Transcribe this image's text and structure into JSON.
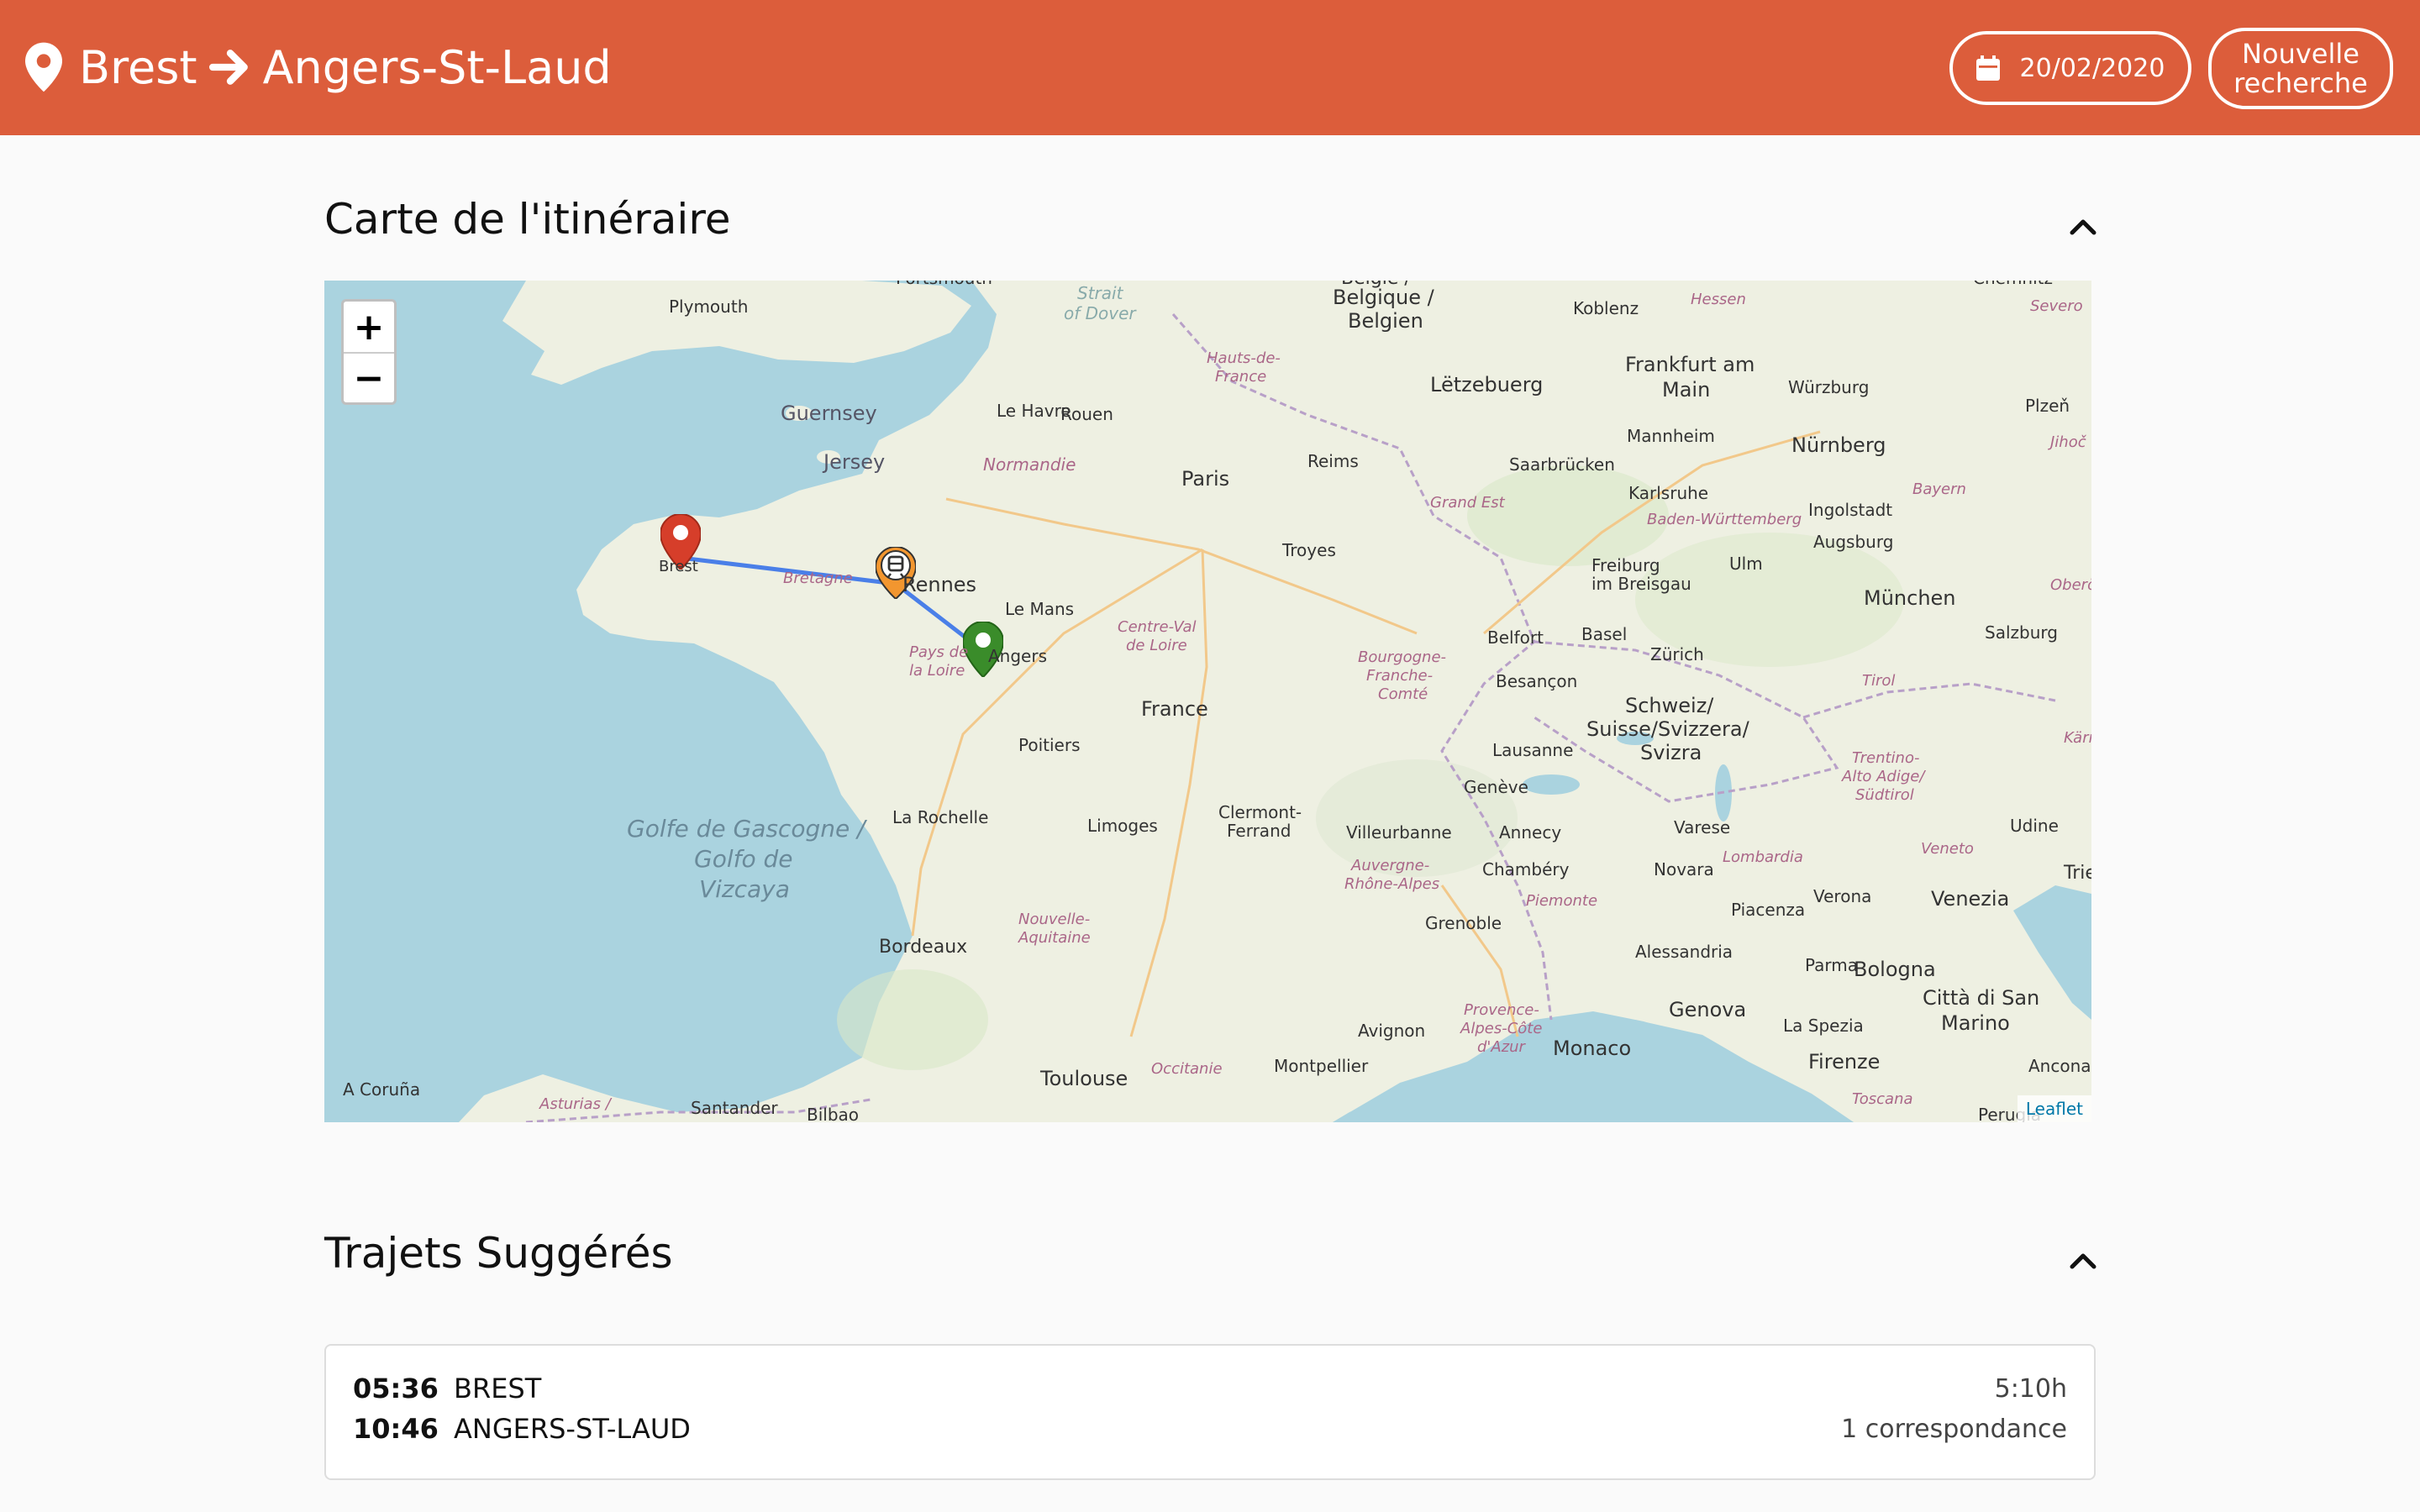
{
  "header": {
    "origin": "Brest",
    "destination": "Angers-St-Laud",
    "date": "20/02/2020",
    "new_search_line1": "Nouvelle",
    "new_search_line2": "recherche"
  },
  "map_section": {
    "title": "Carte de l'itinéraire",
    "zoom_in": "+",
    "zoom_out": "−",
    "attribution": "Leaflet",
    "labels": {
      "plymouth": "Plymouth",
      "portsmouth": "Portsmouth",
      "strait": "Strait",
      "of_dover": "of Dover",
      "guernsey": "Guernsey",
      "jersey": "Jersey",
      "le_havre": "Le Havre",
      "rouen": "Rouen",
      "normandie": "Normandie",
      "hauts": "Hauts-de-",
      "france_r": "France",
      "belgique": "Belgique /",
      "belgien": "Belgien",
      "koblenz": "Koblenz",
      "hessen": "Hessen",
      "frankfurt": "Frankfurt am",
      "main": "Main",
      "wurzburg": "Würzburg",
      "letzebuerg": "Lëtzebuerg",
      "paris": "Paris",
      "reims": "Reims",
      "saarbrucken": "Saarbrücken",
      "mannheim": "Mannheim",
      "nurnberg": "Nürnberg",
      "plzen": "Plzeň",
      "karlsruhe": "Karlsruhe",
      "ingolstadt": "Ingolstadt",
      "bayern": "Bayern",
      "baden": "Baden-Württemberg",
      "augsburg": "Augsburg",
      "grand_est": "Grand Est",
      "troyes": "Troyes",
      "brest": "Brest",
      "bretagne": "Bretagne",
      "rennes": "Rennes",
      "le_mans": "Le Mans",
      "freiburg": "Freiburg",
      "im_breisgau": "im Breisgau",
      "ulm": "Ulm",
      "munchen": "München",
      "oberosterr": "Oberösterr",
      "belfort": "Belfort",
      "basel": "Basel",
      "zurich": "Zürich",
      "salzburg": "Salzburg",
      "centre_val": "Centre-Val",
      "de_loire": "de Loire",
      "pays_de": "Pays de",
      "la_loire": "la Loire",
      "angers": "Angers",
      "bourgogne": "Bourgogne-",
      "franche": "Franche-",
      "comte": "Comté",
      "besancon": "Besançon",
      "tirol": "Tirol",
      "schweiz": "Schweiz/",
      "suisse": "Suisse/Svizzera/",
      "svizra": "Svizra",
      "france": "France",
      "poitiers": "Poitiers",
      "lausanne": "Lausanne",
      "trentino": "Trentino-",
      "alto_adige": "Alto Adige/",
      "sudtirol": "Südtirol",
      "geneve": "Genève",
      "la_rochelle": "La Rochelle",
      "clermont": "Clermont-",
      "ferrand": "Ferrand",
      "limoges": "Limoges",
      "villeurbanne": "Villeurbanne",
      "annecy": "Annecy",
      "varese": "Varese",
      "udine": "Udine",
      "golfe1": "Golfe de Gascogne /",
      "golfe2": "Golfo de",
      "golfe3": "Vizcaya",
      "lombardia": "Lombardia",
      "veneto": "Veneto",
      "auvergne": "Auvergne-",
      "rhone": "Rhône-Alpes",
      "chambery": "Chambéry",
      "novara": "Novara",
      "piemonte": "Piemonte",
      "verona": "Verona",
      "venezia": "Venezia",
      "nouvelle": "Nouvelle-",
      "aquitaine": "Aquitaine",
      "bordeaux": "Bordeaux",
      "grenoble": "Grenoble",
      "piacenza": "Piacenza",
      "alessandria": "Alessandria",
      "parma": "Parma",
      "bologna": "Bologna",
      "genova": "Genova",
      "provence": "Provence-",
      "alpes_cote": "Alpes-Côte",
      "d_azur": "d'Azur",
      "la_spezia": "La Spezia",
      "citta": "Città di San",
      "marino": "Marino",
      "avignon": "Avignon",
      "toulouse": "Toulouse",
      "occitanie": "Occitanie",
      "montpellier": "Montpellier",
      "monaco": "Monaco",
      "firenze": "Firenze",
      "ancona": "Ancona",
      "a_coruna": "A Coruña",
      "asturias": "Asturias /",
      "santander": "Santander",
      "bilbao": "Bilbao",
      "toscana": "Toscana",
      "perugia": "Perugia",
      "chemnitz": "Chemnitz",
      "jihoc": "Jihoč",
      "severo": "Severo",
      "karn": "Kärn",
      "tries": "Tries",
      "belgie": "België /"
    }
  },
  "trips_section": {
    "title": "Trajets Suggérés",
    "trips": [
      {
        "depart_time": "05:36",
        "depart_station": "BREST",
        "arrive_time": "10:46",
        "arrive_station": "ANGERS-ST-LAUD",
        "duration": "5:10h",
        "connections": "1 correspondance"
      }
    ]
  },
  "colors": {
    "header": "#dc5d3b",
    "route_line": "#4a7fe8",
    "origin_marker": "#d63e2a",
    "stop_marker": "#f2962f",
    "destination_marker": "#3a8c2a",
    "sea": "#aad3df",
    "land": "#eef0e2"
  }
}
